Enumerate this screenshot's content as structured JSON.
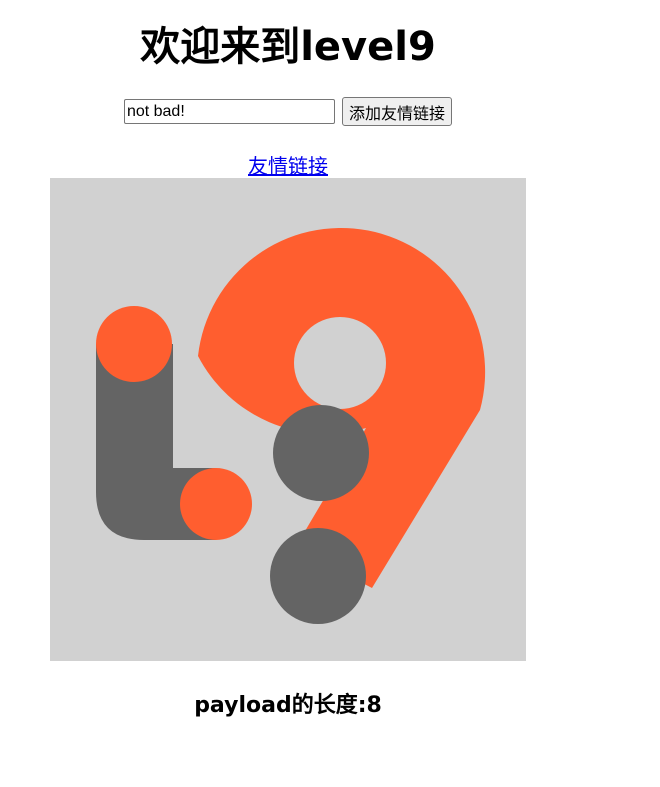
{
  "page": {
    "title": "欢迎来到level9"
  },
  "form": {
    "input_value": "not bad!",
    "submit_label": "添加友情链接"
  },
  "link": {
    "label": "友情链接"
  },
  "logo": {
    "name": "level9-logo",
    "colors": {
      "background": "#d1d1d1",
      "accent": "#ff5e2f",
      "dark": "#646464"
    }
  },
  "result": {
    "payload_length_text": "payload的长度:8"
  }
}
